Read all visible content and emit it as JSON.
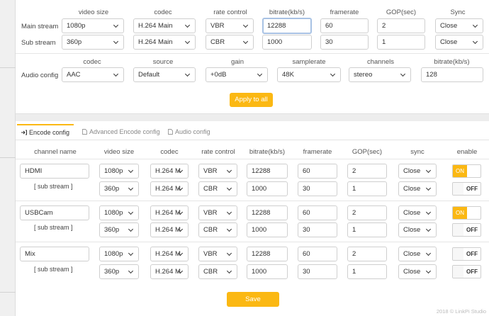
{
  "stream_config": {
    "headers": [
      "video size",
      "codec",
      "rate control",
      "bitrate(kb/s)",
      "framerate",
      "GOP(sec)",
      "Sync"
    ],
    "rows": [
      {
        "label": "Main stream",
        "video_size": "1080p",
        "codec": "H.264 Main",
        "rate_control": "VBR",
        "bitrate": "12288",
        "framerate": "60",
        "gop": "2",
        "sync": "Close"
      },
      {
        "label": "Sub stream",
        "video_size": "360p",
        "codec": "H.264 Main",
        "rate_control": "CBR",
        "bitrate": "1000",
        "framerate": "30",
        "gop": "1",
        "sync": "Close"
      }
    ]
  },
  "audio_config": {
    "headers": [
      "codec",
      "source",
      "gain",
      "samplerate",
      "channels",
      "bitrate(kb/s)"
    ],
    "label": "Audio config",
    "codec": "AAC",
    "source": "Default",
    "gain": "+0dB",
    "samplerate": "48K",
    "channels": "stereo",
    "bitrate": "128"
  },
  "apply_label": "Apply to all",
  "tabs": [
    "Encode config",
    "Advanced Encode config",
    "Audio config"
  ],
  "encode_table": {
    "headers": [
      "channel name",
      "video size",
      "codec",
      "rate control",
      "bitrate(kb/s)",
      "framerate",
      "GOP(sec)",
      "sync",
      "enable"
    ],
    "sub_label": "[ sub stream ]",
    "channels": [
      {
        "name": "HDMI",
        "main": {
          "video_size": "1080p",
          "codec": "H.264 M",
          "rate_control": "VBR",
          "bitrate": "12288",
          "framerate": "60",
          "gop": "2",
          "sync": "Close",
          "enable": "ON"
        },
        "sub": {
          "video_size": "360p",
          "codec": "H.264 M",
          "rate_control": "CBR",
          "bitrate": "1000",
          "framerate": "30",
          "gop": "1",
          "sync": "Close",
          "enable": "OFF"
        }
      },
      {
        "name": "USBCam",
        "main": {
          "video_size": "1080p",
          "codec": "H.264 M",
          "rate_control": "VBR",
          "bitrate": "12288",
          "framerate": "60",
          "gop": "2",
          "sync": "Close",
          "enable": "ON"
        },
        "sub": {
          "video_size": "360p",
          "codec": "H.264 M",
          "rate_control": "CBR",
          "bitrate": "1000",
          "framerate": "30",
          "gop": "1",
          "sync": "Close",
          "enable": "OFF"
        }
      },
      {
        "name": "Mix",
        "main": {
          "video_size": "1080p",
          "codec": "H.264 M",
          "rate_control": "VBR",
          "bitrate": "12288",
          "framerate": "60",
          "gop": "2",
          "sync": "Close",
          "enable": "OFF"
        },
        "sub": {
          "video_size": "360p",
          "codec": "H.264 M",
          "rate_control": "CBR",
          "bitrate": "1000",
          "framerate": "30",
          "gop": "1",
          "sync": "Close",
          "enable": "OFF"
        }
      }
    ]
  },
  "save_label": "Save",
  "copyright": "2018 © LinkPi Studio",
  "colors": {
    "accent": "#fbb813",
    "focus_border": "#a8c2e4"
  }
}
